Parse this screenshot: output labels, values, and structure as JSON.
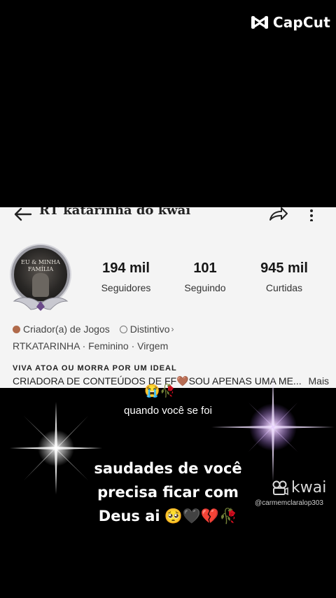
{
  "watermark": {
    "brand": "CapCut",
    "icon": "capcut-logo-icon"
  },
  "profile": {
    "username": "RT katarinha do kwai",
    "icons": {
      "back": "back-arrow-icon",
      "share": "share-icon",
      "more": "more-vertical-icon"
    },
    "avatar_caption": "EU & MINHA FAMÍLIA",
    "stats": [
      {
        "value": "194 mil",
        "label": "Seguidores"
      },
      {
        "value": "101",
        "label": "Seguindo"
      },
      {
        "value": "945 mil",
        "label": "Curtidas"
      }
    ],
    "badges": {
      "creator": "Criador(a) de Jogos",
      "distinct": "Distintivo",
      "chevron": "›"
    },
    "meta": "RTKATARINHA · Feminino · Virgem",
    "motto": "VIVA ATOA OU MORRA POR UM IDEAL",
    "bio": "CRIADORA DE CONTEÚDOS DE FF🤎SOU APENAS UMA ME...",
    "bio_more": "Mais"
  },
  "overlay": {
    "emoji_top": "😭🥀",
    "caption": "quando você se foi",
    "line1": "saudades de você",
    "line2": "precisa ficar com",
    "line3": "Deus ai",
    "line3_emojis": "🥺🖤💔🥀"
  },
  "kwai": {
    "brand": "kwai",
    "handle": "@carmemclaralop303"
  },
  "colors": {
    "profile_bg": "#f4f4f4",
    "background": "#000000",
    "accent_creator": "#b06a4a"
  }
}
